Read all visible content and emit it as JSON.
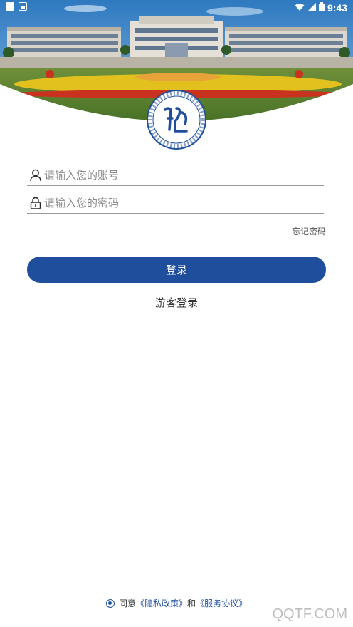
{
  "status_bar": {
    "time": "9:43",
    "icons": [
      "app-notification-icon",
      "image-notification-icon",
      "wifi-icon",
      "signal-icon",
      "battery-icon"
    ]
  },
  "header": {
    "image": "campus-building-photo",
    "logo": "college-emblem-logo"
  },
  "form": {
    "account": {
      "icon": "user-icon",
      "placeholder": "请输入您的账号",
      "value": ""
    },
    "password": {
      "icon": "lock-icon",
      "placeholder": "请输入您的密码",
      "value": ""
    },
    "forgot_label": "忘记密码",
    "login_label": "登录",
    "guest_label": "游客登录"
  },
  "agreement": {
    "checked": true,
    "prefix": "同意",
    "privacy_link": "《隐私政策》",
    "conjunction": "和",
    "service_link": "《服务协议》"
  },
  "watermark": "QQTF.COM",
  "colors": {
    "brand": "#1f4f9c",
    "sky": "#4a90c8",
    "text": "#333333",
    "placeholder": "#8a8a8a"
  }
}
